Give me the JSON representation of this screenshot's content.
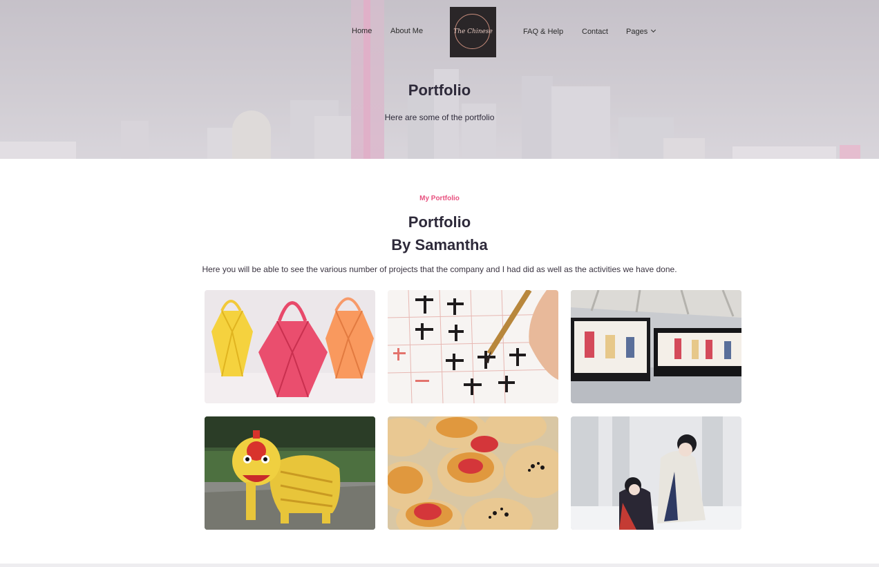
{
  "nav": {
    "left": [
      "Home",
      "About Me"
    ],
    "right": [
      "FAQ & Help",
      "Contact",
      "Pages"
    ],
    "logo_text": "The Chinese"
  },
  "hero": {
    "title": "Portfolio",
    "subtitle": "Here are some of the portfolio"
  },
  "portfolio": {
    "kicker": "My Portfolio",
    "title_line1": "Portfolio",
    "title_line2": "By Samantha",
    "description": "Here you will be able to see the various number of projects that the company and I had did as well as the activities we have done."
  },
  "colors": {
    "accent": "#e8517f",
    "heading": "#2e2a3a"
  },
  "icons": {
    "pages_dropdown": "chevron-down-icon"
  }
}
